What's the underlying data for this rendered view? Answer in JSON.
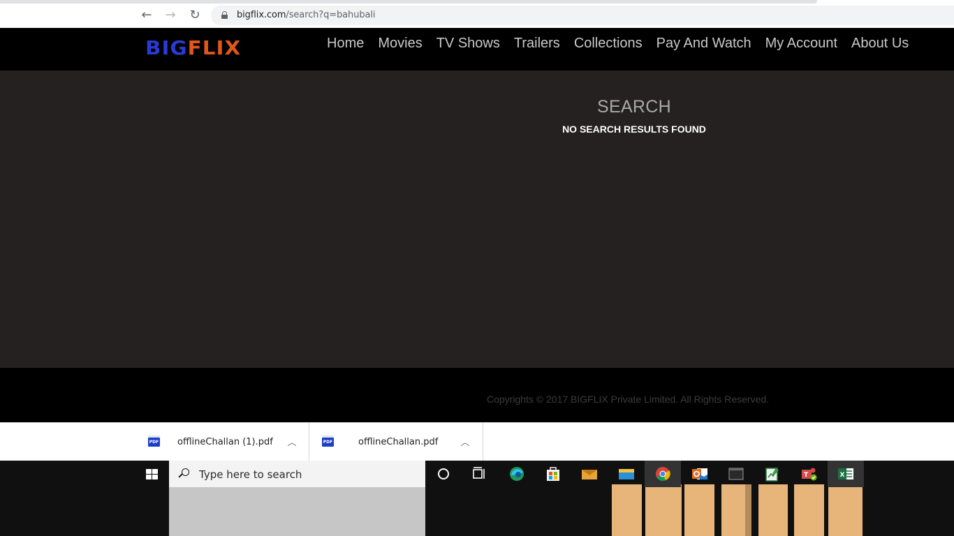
{
  "browser": {
    "url_host": "bigflix.com",
    "url_path": "/search?q=bahubali",
    "back_icon": "←",
    "forward_icon": "→",
    "reload_icon": "↻"
  },
  "site": {
    "logo_part1": "BIG",
    "logo_part2": "FLIX",
    "nav": [
      "Home",
      "Movies",
      "TV Shows",
      "Trailers",
      "Collections",
      "Pay And Watch",
      "My Account",
      "About Us"
    ]
  },
  "main": {
    "title": "SEARCH",
    "message": "NO SEARCH RESULTS FOUND"
  },
  "footer": {
    "copyright": "Copyrights © 2017 BIGFLIX Private Limited. All Rights Reserved."
  },
  "downloads": [
    {
      "name": "offlineChallan (1).pdf",
      "icon_text": "PDF"
    },
    {
      "name": "offlineChallan.pdf",
      "icon_text": "PDF"
    }
  ],
  "taskbar": {
    "search_placeholder": "Type here to search",
    "icons": [
      "cortana-icon",
      "task-view-icon",
      "edge-icon",
      "store-icon",
      "mail-icon",
      "file-explorer-icon",
      "chrome-icon",
      "outlook-icon",
      "terminal-icon",
      "notepad-icon",
      "teams-icon",
      "excel-icon"
    ]
  },
  "colors": {
    "logo_blue": "#2a3ad6",
    "logo_orange": "#e0571a",
    "main_bg": "#252120"
  }
}
